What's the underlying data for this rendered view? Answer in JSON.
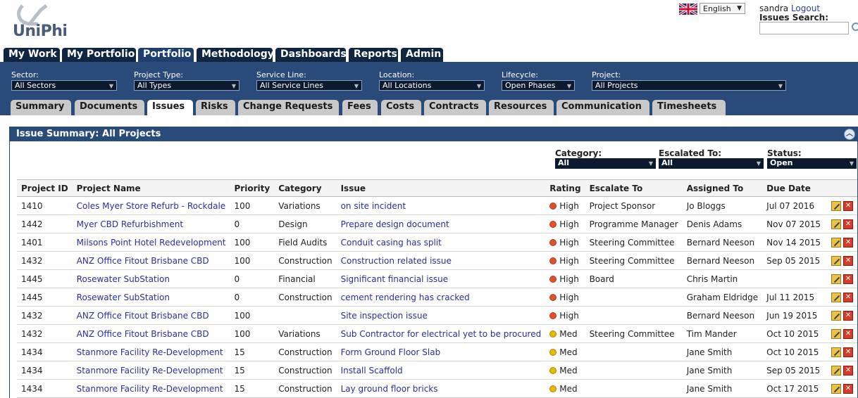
{
  "header": {
    "logo_text": "UniPhi",
    "language": "English",
    "username": "sandra",
    "logout_label": "Logout",
    "issues_search_label": "Issues Search:",
    "issues_search_value": ""
  },
  "main_nav": {
    "tabs": [
      {
        "label": "My Work"
      },
      {
        "label": "My Portfolio"
      },
      {
        "label": "Portfolio"
      },
      {
        "label": "Methodology"
      },
      {
        "label": "Dashboards"
      },
      {
        "label": "Reports"
      },
      {
        "label": "Admin"
      }
    ],
    "active": "Portfolio"
  },
  "filters": {
    "sector": {
      "label": "Sector:",
      "value": "All Sectors"
    },
    "project_type": {
      "label": "Project Type:",
      "value": "All Types"
    },
    "service_line": {
      "label": "Service Line:",
      "value": "All Service Lines"
    },
    "location": {
      "label": "Location:",
      "value": "All Locations"
    },
    "lifecycle": {
      "label": "Lifecycle:",
      "value": "Open Phases"
    },
    "project": {
      "label": "Project:",
      "value": "All Projects"
    }
  },
  "sub_tabs": {
    "tabs": [
      {
        "label": "Summary"
      },
      {
        "label": "Documents"
      },
      {
        "label": "Issues"
      },
      {
        "label": "Risks"
      },
      {
        "label": "Change Requests"
      },
      {
        "label": "Fees"
      },
      {
        "label": "Costs"
      },
      {
        "label": "Contracts"
      },
      {
        "label": "Resources"
      },
      {
        "label": "Communication"
      },
      {
        "label": "Timesheets"
      }
    ],
    "active": "Issues"
  },
  "panel": {
    "title": "Issue Summary: All Projects",
    "filters": {
      "category": {
        "label": "Category:",
        "value": "All"
      },
      "escalated_to": {
        "label": "Escalated To:",
        "value": "All"
      },
      "status": {
        "label": "Status:",
        "value": "Open"
      }
    }
  },
  "table": {
    "columns": [
      "Project ID",
      "Project Name",
      "Priority",
      "Category",
      "Issue",
      "Rating",
      "Escalate To",
      "Assigned To",
      "Due Date"
    ],
    "rows": [
      {
        "id": "1410",
        "name": "Coles Myer Store Refurb - Rockdale",
        "priority": "100",
        "category": "Variations",
        "issue": "on site incident",
        "rating": "High",
        "escalate": "Project Sponsor",
        "assigned": "Jo Bloggs",
        "due": "Jul 07 2016"
      },
      {
        "id": "1442",
        "name": "Myer CBD Refurbishment",
        "priority": "0",
        "category": "Design",
        "issue": "Prepare design document",
        "rating": "High",
        "escalate": "Programme Manager",
        "assigned": "Denis Adams",
        "due": "Nov 07 2015"
      },
      {
        "id": "1401",
        "name": "Milsons Point Hotel Redevelopment",
        "priority": "100",
        "category": "Field Audits",
        "issue": "Conduit casing has split",
        "rating": "High",
        "escalate": "Steering Committee",
        "assigned": "Bernard Neeson",
        "due": "Nov 14 2015"
      },
      {
        "id": "1432",
        "name": "ANZ Office Fitout Brisbane CBD",
        "priority": "100",
        "category": "Construction",
        "issue": "Construction related issue",
        "rating": "High",
        "escalate": "Steering Committee",
        "assigned": "Bernard Neeson",
        "due": "Sep 05 2015"
      },
      {
        "id": "1445",
        "name": "Rosewater SubStation",
        "priority": "0",
        "category": "Financial",
        "issue": "Significant financial issue",
        "rating": "High",
        "escalate": "Board",
        "assigned": "Chris Martin",
        "due": ""
      },
      {
        "id": "1445",
        "name": "Rosewater SubStation",
        "priority": "0",
        "category": "Construction",
        "issue": "cement rendering has cracked",
        "rating": "High",
        "escalate": "",
        "assigned": "Graham Eldridge",
        "due": "Jul 11 2015"
      },
      {
        "id": "1432",
        "name": "ANZ Office Fitout Brisbane CBD",
        "priority": "100",
        "category": "",
        "issue": "Site inspection issue",
        "rating": "High",
        "escalate": "",
        "assigned": "Bernard Neeson",
        "due": "Jun 19 2015"
      },
      {
        "id": "1432",
        "name": "ANZ Office Fitout Brisbane CBD",
        "priority": "100",
        "category": "Variations",
        "issue": "Sub Contractor for electrical yet to be procured",
        "rating": "Med",
        "escalate": "Steering Committee",
        "assigned": "Tim Mander",
        "due": "Oct 10 2015"
      },
      {
        "id": "1434",
        "name": "Stanmore Facility Re-Development",
        "priority": "15",
        "category": "Construction",
        "issue": "Form Ground Floor Slab",
        "rating": "Med",
        "escalate": "",
        "assigned": "Jane Smith",
        "due": "Oct 10 2015"
      },
      {
        "id": "1434",
        "name": "Stanmore Facility Re-Development",
        "priority": "15",
        "category": "Construction",
        "issue": "Install Scaffold",
        "rating": "Med",
        "escalate": "",
        "assigned": "Jane Smith",
        "due": "Sep 05 2015"
      },
      {
        "id": "1434",
        "name": "Stanmore Facility Re-Development",
        "priority": "15",
        "category": "Construction",
        "issue": "Lay ground floor bricks",
        "rating": "Med",
        "escalate": "",
        "assigned": "Jane Smith",
        "due": "Oct 17 2015"
      }
    ]
  },
  "colors": {
    "band": "#2a4a7a",
    "nav_tab": "#10253f",
    "high_rating": "#e0512b",
    "med_rating": "#e6b800",
    "link": "#2b2f9c"
  }
}
